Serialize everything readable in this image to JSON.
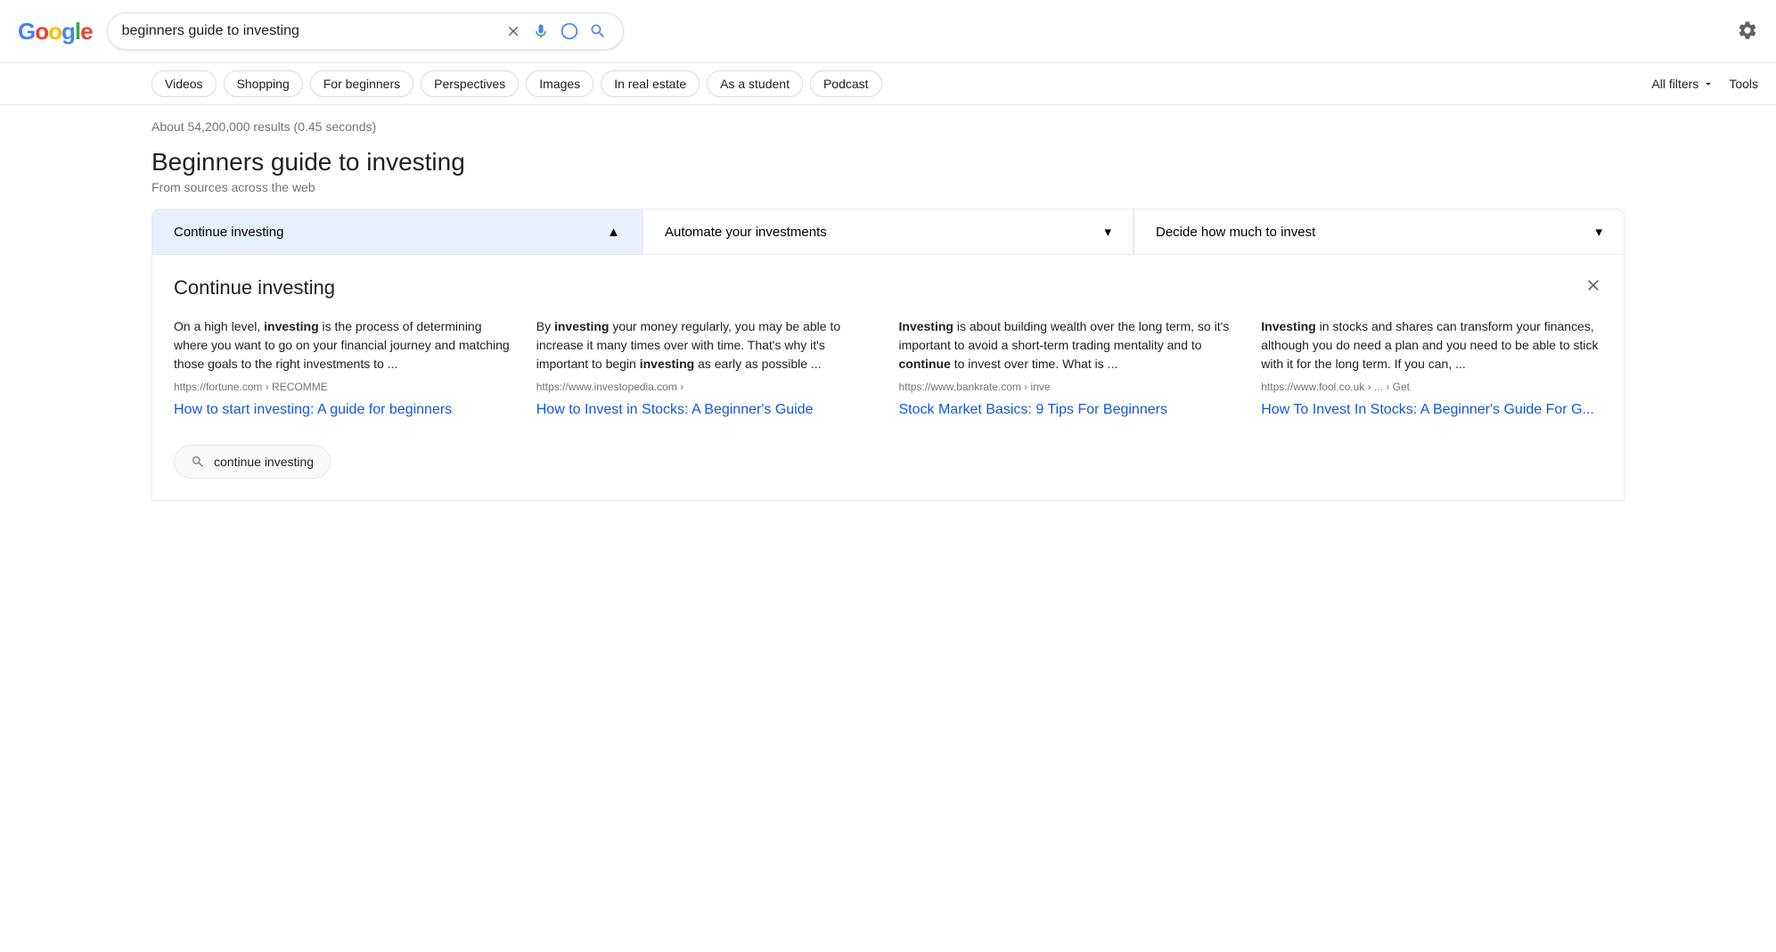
{
  "header": {
    "search_query": "beginners guide to investing",
    "clear_label": "×",
    "gear_icon": "⚙",
    "search_icon": "🔍"
  },
  "filters": {
    "chips": [
      {
        "label": "Videos",
        "id": "videos"
      },
      {
        "label": "Shopping",
        "id": "shopping"
      },
      {
        "label": "For beginners",
        "id": "for-beginners"
      },
      {
        "label": "Perspectives",
        "id": "perspectives"
      },
      {
        "label": "Images",
        "id": "images"
      },
      {
        "label": "In real estate",
        "id": "in-real-estate"
      },
      {
        "label": "As a student",
        "id": "as-a-student"
      },
      {
        "label": "Podcast",
        "id": "podcast"
      }
    ],
    "all_filters_label": "All filters",
    "tools_label": "Tools"
  },
  "results": {
    "count_text": "About 54,200,000 results (0.45 seconds)",
    "panel": {
      "title": "Beginners guide to investing",
      "subtitle": "From sources across the web",
      "accordion": [
        {
          "label": "Continue investing",
          "active": true,
          "icon": "▲"
        },
        {
          "label": "Automate your investments",
          "active": false,
          "icon": "▾"
        },
        {
          "label": "Decide how much to invest",
          "active": false,
          "icon": "▾"
        }
      ]
    },
    "expanded": {
      "title": "Continue investing",
      "cards": [
        {
          "snippet_parts": [
            {
              "text": "On a high level, ",
              "bold": false
            },
            {
              "text": "investing",
              "bold": true
            },
            {
              "text": " is the process of determining where you want to go on your financial journey and matching those goals to the right investments to ...",
              "bold": false
            }
          ],
          "url": "https://fortune.com › RECOMME",
          "link_text": "How to start investing: A guide for beginners",
          "link_href": "#"
        },
        {
          "snippet_parts": [
            {
              "text": "By ",
              "bold": false
            },
            {
              "text": "investing",
              "bold": true
            },
            {
              "text": " your money regularly, you may be able to increase it many times over with time. That's why it's important to begin ",
              "bold": false
            },
            {
              "text": "investing",
              "bold": true
            },
            {
              "text": " as early as possible ...",
              "bold": false
            }
          ],
          "url": "https://www.investopedia.com ›",
          "link_text": "How to Invest in Stocks: A Beginner's Guide",
          "link_href": "#"
        },
        {
          "snippet_parts": [
            {
              "text": "Investing",
              "bold": true
            },
            {
              "text": " is about building wealth over the long term, so it's important to avoid a short-term trading mentality and to ",
              "bold": false
            },
            {
              "text": "continue",
              "bold": true
            },
            {
              "text": " to invest over time. What is ...",
              "bold": false
            }
          ],
          "url": "https://www.bankrate.com › inve",
          "link_text": "Stock Market Basics: 9 Tips For Beginners",
          "link_href": "#"
        },
        {
          "snippet_parts": [
            {
              "text": "Investing",
              "bold": true
            },
            {
              "text": " in stocks and shares can transform your finances, although you do need a plan and you need to be able to stick with it for the long term. If you can, ...",
              "bold": false
            }
          ],
          "url": "https://www.fool.co.uk › ... › Get",
          "link_text": "How To Invest In Stocks: A Beginner's Guide For G...",
          "link_href": "#"
        }
      ],
      "suggestion": {
        "query": "continue investing",
        "icon": "🔍"
      }
    }
  }
}
